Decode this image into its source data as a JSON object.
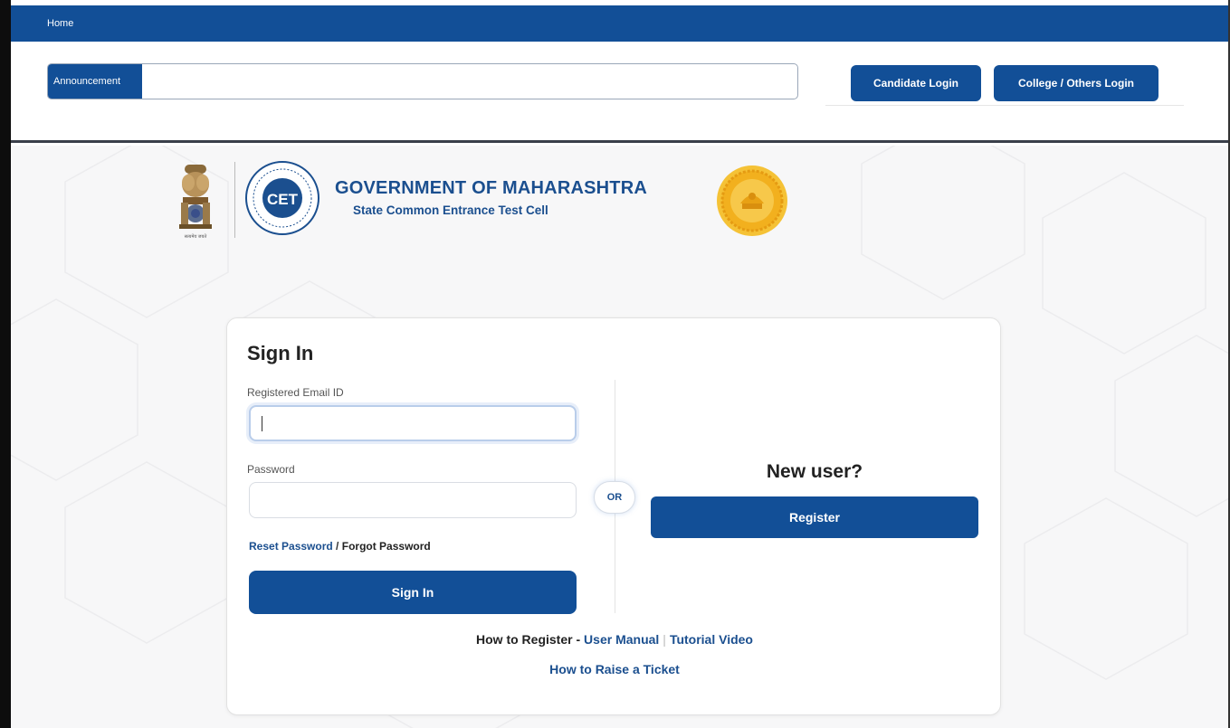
{
  "nav": {
    "home_label": "Home"
  },
  "announcement": {
    "label": "Announcement",
    "text": ""
  },
  "login_buttons": {
    "candidate": "Candidate Login",
    "college": "College / Others Login"
  },
  "header": {
    "title": "GOVERNMENT OF MAHARASHTRA",
    "subtitle": "State Common Entrance Test Cell",
    "cet_logo_text": "CET",
    "emblem_caption": "सत्यमेव जयते"
  },
  "signin": {
    "title": "Sign In",
    "email_label": "Registered Email ID",
    "email_value": "",
    "password_label": "Password",
    "password_value": "",
    "reset_link": "Reset Password",
    "separator": " / ",
    "forgot_link": "Forgot Password",
    "button": "Sign In"
  },
  "or_label": "OR",
  "register": {
    "heading": "New user?",
    "button": "Register"
  },
  "help": {
    "how_to_register": "How to Register",
    "dash": " - ",
    "user_manual": "User Manual",
    "pipe": "|",
    "tutorial_video": "Tutorial Video",
    "raise_ticket": "How to Raise a Ticket"
  },
  "colors": {
    "primary": "#124f97",
    "heading_blue": "#1b4f8f",
    "seal_gold": "#f2b01e",
    "background": "#f7f7f8"
  },
  "icons": [
    "national-emblem-icon",
    "cet-logo-icon",
    "maharashtra-seal-icon"
  ]
}
